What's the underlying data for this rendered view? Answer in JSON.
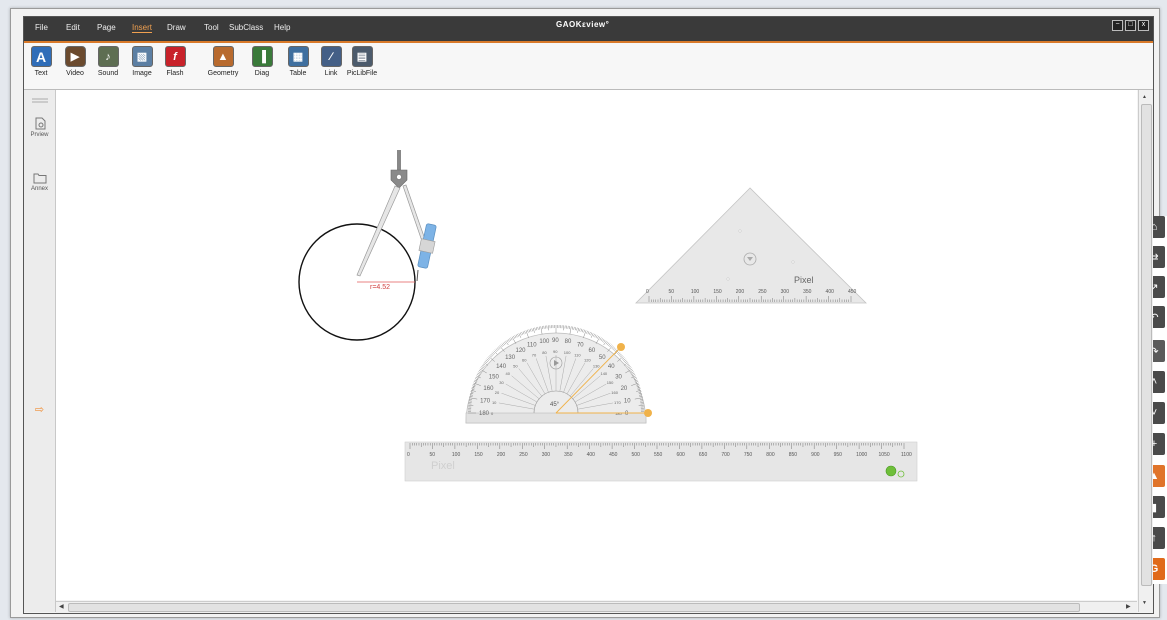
{
  "window": {
    "app_name": "GAOKEview",
    "logo_text": "GAOKεview°",
    "menu": [
      {
        "label": "File"
      },
      {
        "label": "Edit"
      },
      {
        "label": "Page"
      },
      {
        "label": "Insert"
      },
      {
        "label": "Draw"
      },
      {
        "label": "Tool"
      },
      {
        "label": "SubClass"
      },
      {
        "label": "Help"
      }
    ],
    "active_menu": "Insert",
    "controls": {
      "minimize": "−",
      "maximize": "□",
      "close": "x"
    }
  },
  "toolbar": {
    "items": [
      {
        "label": "Text",
        "icon": "text-icon",
        "glyph": "A"
      },
      {
        "label": "Video",
        "icon": "video-icon",
        "glyph": "▶"
      },
      {
        "label": "Sound",
        "icon": "sound-icon",
        "glyph": "♪"
      },
      {
        "label": "Image",
        "icon": "image-icon",
        "glyph": "▧"
      },
      {
        "label": "Flash",
        "icon": "flash-icon",
        "glyph": "f"
      },
      {
        "label": "Geometry",
        "icon": "geometry-icon",
        "glyph": "▲"
      },
      {
        "label": "Diag",
        "icon": "diagram-icon",
        "glyph": "▐"
      },
      {
        "label": "Table",
        "icon": "table-icon",
        "glyph": "▦"
      },
      {
        "label": "Link",
        "icon": "link-icon",
        "glyph": "∕"
      },
      {
        "label": "PicLibFile",
        "icon": "picture-library-icon",
        "glyph": "▤"
      }
    ]
  },
  "leftbar": {
    "preview_label": "Prview",
    "annex_label": "Annex",
    "arrow": "⇨"
  },
  "canvas": {
    "compass_radius_label": "r=4.52",
    "triangle_unit": "Pixel",
    "triangle_ticks": [
      "0",
      "50",
      "100",
      "150",
      "200",
      "250",
      "300",
      "350",
      "400",
      "450"
    ],
    "ruler_unit": "Pixel",
    "ruler_ticks": [
      "0",
      "50",
      "100",
      "150",
      "200",
      "250",
      "300",
      "350",
      "400",
      "450",
      "500",
      "550",
      "600",
      "650",
      "700",
      "750",
      "800",
      "850",
      "900",
      "950",
      "1000",
      "1050",
      "1100"
    ],
    "protractor_angle_label": "45°",
    "protractor_outer_ticks": [
      "180",
      "170",
      "160",
      "150",
      "140",
      "130",
      "120",
      "110",
      "100",
      "90",
      "80",
      "70",
      "60",
      "50",
      "40",
      "30",
      "20",
      "10",
      "0"
    ],
    "protractor_inner_ticks": [
      "0",
      "10",
      "20",
      "30",
      "40",
      "50",
      "60",
      "70",
      "80",
      "90",
      "100",
      "110",
      "120",
      "130",
      "140",
      "150",
      "160",
      "170",
      "180"
    ]
  },
  "right_tools": {
    "buttons": [
      {
        "name": "home-button",
        "icon": "home-icon",
        "glyph": "⌂",
        "color": "#4a4a4a"
      },
      {
        "name": "switch-button",
        "icon": "switch-icon",
        "glyph": "⇄",
        "color": "#4a4a4a"
      },
      {
        "name": "pointer-button",
        "icon": "pointer-icon",
        "glyph": "↗",
        "color": "#4a4a4a"
      },
      {
        "name": "undo-button",
        "icon": "undo-icon",
        "glyph": "↶",
        "color": "#4a4a4a"
      },
      {
        "name": "redo-button",
        "icon": "redo-icon",
        "glyph": "↷",
        "color": "#5a5a5a"
      },
      {
        "name": "page-up-button",
        "icon": "chevron-up-icon",
        "glyph": "˄",
        "color": "#4a4a4a"
      },
      {
        "name": "page-down-button",
        "icon": "chevron-down-icon",
        "glyph": "˅",
        "color": "#4a4a4a"
      },
      {
        "name": "add-page-button",
        "icon": "plus-icon",
        "glyph": "+",
        "color": "#4a4a4a"
      },
      {
        "name": "pen-button",
        "icon": "pen-icon",
        "glyph": "▲",
        "color": "#e0742a"
      },
      {
        "name": "eraser-button",
        "icon": "eraser-icon",
        "glyph": "▮",
        "color": "#4a4a4a"
      },
      {
        "name": "upload-button",
        "icon": "upload-icon",
        "glyph": "↑",
        "color": "#4a4a4a"
      },
      {
        "name": "gaoke-button",
        "icon": "gaoke-logo-icon",
        "glyph": "G",
        "color": "#e06a1a"
      }
    ]
  },
  "colors": {
    "menubar": "#3a3a3a",
    "accent": "#d97a2a",
    "compass_label": "#d04040"
  }
}
